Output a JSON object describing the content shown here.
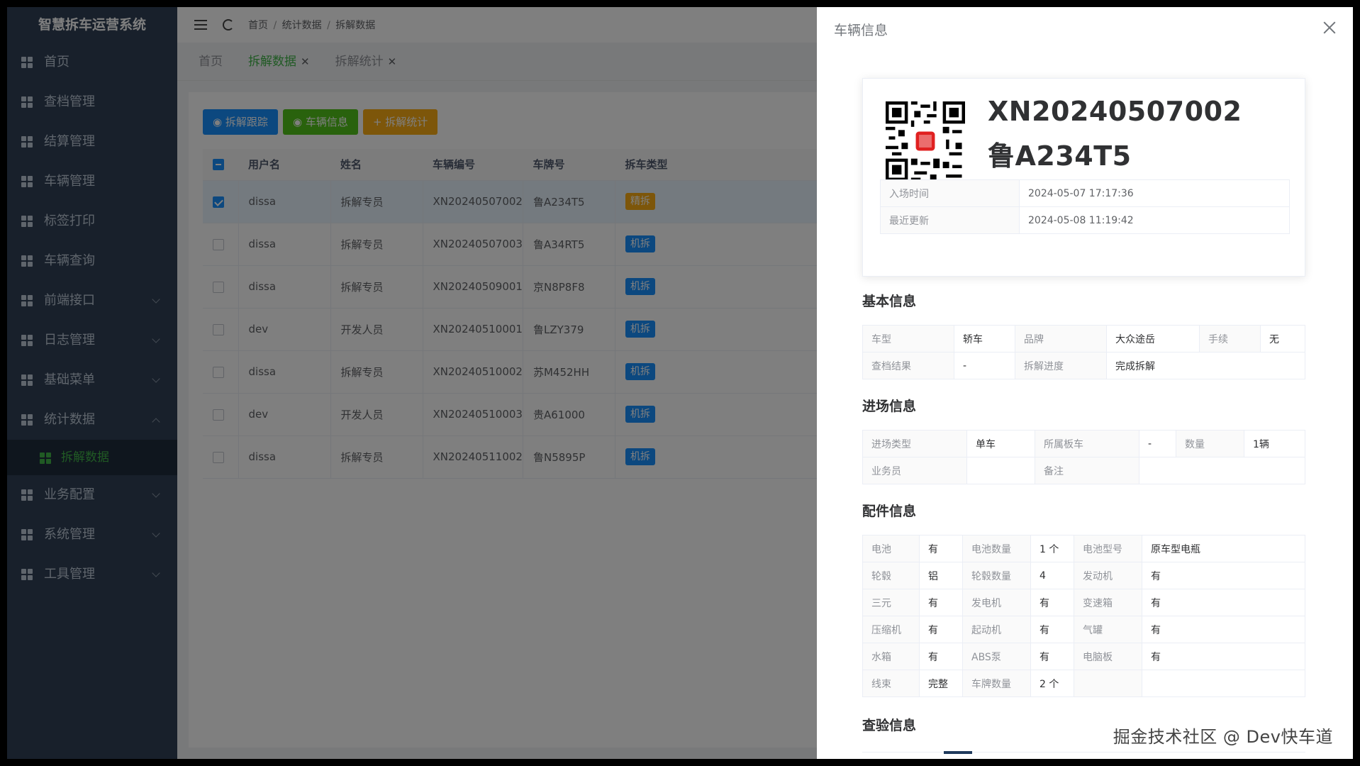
{
  "app_title": "智慧拆车运营系统",
  "sidebar": {
    "items": [
      {
        "label": "首页"
      },
      {
        "label": "查档管理"
      },
      {
        "label": "结算管理"
      },
      {
        "label": "车辆管理"
      },
      {
        "label": "标签打印"
      },
      {
        "label": "车辆查询"
      },
      {
        "label": "前端接口"
      },
      {
        "label": "日志管理"
      },
      {
        "label": "基础菜单"
      },
      {
        "label": "统计数据"
      },
      {
        "label": "业务配置"
      },
      {
        "label": "系统管理"
      },
      {
        "label": "工具管理"
      }
    ],
    "sub_item": "拆解数据"
  },
  "breadcrumb": {
    "home": "首页",
    "sep": "/",
    "level1": "统计数据",
    "level2": "拆解数据"
  },
  "tabs": [
    {
      "label": "首页"
    },
    {
      "label": "拆解数据"
    },
    {
      "label": "拆解统计"
    }
  ],
  "toolbar": {
    "track": "拆解跟踪",
    "info": "车辆信息",
    "stats": "拆解统计"
  },
  "table": {
    "headers": [
      "用户名",
      "姓名",
      "车辆编号",
      "车牌号",
      "拆车类型"
    ],
    "rows": [
      [
        "dissa",
        "拆解专员",
        "XN20240507002",
        "鲁A234T5",
        "精拆"
      ],
      [
        "dissa",
        "拆解专员",
        "XN20240507003",
        "鲁A34RT5",
        "机拆"
      ],
      [
        "dissa",
        "拆解专员",
        "XN20240509001",
        "京N8P8F8",
        "机拆"
      ],
      [
        "dev",
        "开发人员",
        "XN20240510001",
        "鲁LZY379",
        "机拆"
      ],
      [
        "dissa",
        "拆解专员",
        "XN20240510002",
        "苏M452HH",
        "机拆"
      ],
      [
        "dev",
        "开发人员",
        "XN20240510003",
        "贵A61000",
        "机拆"
      ],
      [
        "dissa",
        "拆解专员",
        "XN20240511002",
        "鲁N5895P",
        "机拆"
      ]
    ]
  },
  "drawer": {
    "title": "车辆信息",
    "vehicle_no": "XN20240507002",
    "plate": "鲁A234T5",
    "entry_time_label": "入场时间",
    "entry_time": "2024-05-07 17:17:36",
    "updated_label": "最近更新",
    "updated": "2024-05-08 11:19:42",
    "basic": {
      "title": "基本信息",
      "r1": [
        "车型",
        "轿车",
        "品牌",
        "大众途岳",
        "手续",
        "无"
      ],
      "r2": [
        "查档结果",
        "-",
        "拆解进度",
        "完成拆解"
      ]
    },
    "entry": {
      "title": "进场信息",
      "r1": [
        "进场类型",
        "单车",
        "所属板车",
        "-",
        "数量",
        "1辆"
      ],
      "r2": [
        "业务员",
        "",
        "备注",
        ""
      ]
    },
    "parts": {
      "title": "配件信息",
      "rows": [
        [
          "电池",
          "有",
          "电池数量",
          "1 个",
          "电池型号",
          "原车型电瓶"
        ],
        [
          "轮毂",
          "铝",
          "轮毂数量",
          "4",
          "发动机",
          "有"
        ],
        [
          "三元",
          "有",
          "发电机",
          "有",
          "变速箱",
          "有"
        ],
        [
          "压缩机",
          "有",
          "起动机",
          "有",
          "气罐",
          "有"
        ],
        [
          "水箱",
          "有",
          "ABS泵",
          "有",
          "电脑板",
          "有"
        ],
        [
          "线束",
          "完整",
          "车牌数量",
          "2 个",
          "",
          ""
        ]
      ]
    },
    "inspect_title": "查验信息"
  },
  "watermark": "掘金技术社区 @ Dev快车道"
}
